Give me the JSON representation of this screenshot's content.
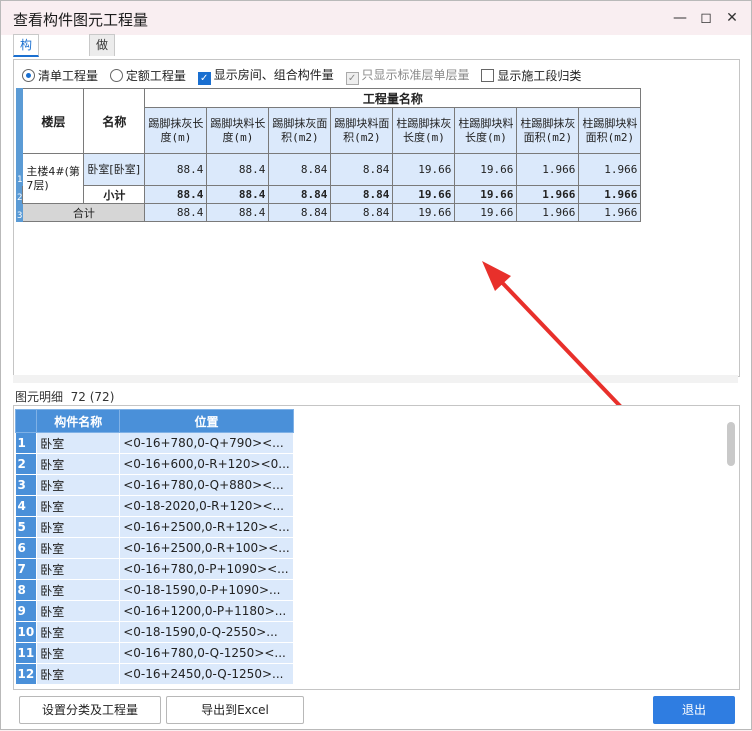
{
  "window": {
    "title": "查看构件图元工程量"
  },
  "tabs": [
    "构件工程量",
    "做法工程量"
  ],
  "options": {
    "radio_list": "清单工程量",
    "radio_quota": "定额工程量",
    "cb_show_room": "显示房间、组合构件量",
    "cb_standard_floor": "只显示标准层单层量",
    "cb_construction": "显示施工段归类"
  },
  "qty_table": {
    "floor_header": "楼层",
    "name_header": "名称",
    "group_header": "工程量名称",
    "columns": [
      "踢脚抹灰长度(m)",
      "踢脚块料长度(m)",
      "踢脚抹灰面积(m2)",
      "踢脚块料面积(m2)",
      "柱踢脚抹灰长度(m)",
      "柱踢脚块料长度(m)",
      "柱踢脚抹灰面积(m2)",
      "柱踢脚块料面积(m2)"
    ],
    "row_numbers": [
      "1",
      "2",
      "3"
    ],
    "floor": "主楼4#(第7层)",
    "name": "卧室[卧室]",
    "values": [
      "88.4",
      "88.4",
      "8.84",
      "8.84",
      "19.66",
      "19.66",
      "1.966",
      "1.966"
    ],
    "subtotal_label": "小计",
    "subtotal": [
      "88.4",
      "88.4",
      "8.84",
      "8.84",
      "19.66",
      "19.66",
      "1.966",
      "1.966"
    ],
    "total_label": "合计",
    "total": [
      "88.4",
      "88.4",
      "8.84",
      "8.84",
      "19.66",
      "19.66",
      "1.966",
      "1.966"
    ]
  },
  "detail": {
    "label": "图元明细",
    "count": "72 (72)",
    "col_name": "构件名称",
    "col_pos": "位置",
    "rows": [
      {
        "n": "1",
        "name": "卧室",
        "pos": "<0-16+780,0-Q+790><..."
      },
      {
        "n": "2",
        "name": "卧室",
        "pos": "<0-16+600,0-R+120><0..."
      },
      {
        "n": "3",
        "name": "卧室",
        "pos": "<0-16+780,0-Q+880><..."
      },
      {
        "n": "4",
        "name": "卧室",
        "pos": "<0-18-2020,0-R+120><..."
      },
      {
        "n": "5",
        "name": "卧室",
        "pos": "<0-16+2500,0-R+120><..."
      },
      {
        "n": "6",
        "name": "卧室",
        "pos": "<0-16+2500,0-R+100><..."
      },
      {
        "n": "7",
        "name": "卧室",
        "pos": "<0-16+780,0-P+1090><..."
      },
      {
        "n": "8",
        "name": "卧室",
        "pos": "<0-18-1590,0-P+1090>..."
      },
      {
        "n": "9",
        "name": "卧室",
        "pos": "<0-16+1200,0-P+1180>..."
      },
      {
        "n": "10",
        "name": "卧室",
        "pos": "<0-18-1590,0-Q-2550>..."
      },
      {
        "n": "11",
        "name": "卧室",
        "pos": "<0-16+780,0-Q-1250><..."
      },
      {
        "n": "12",
        "name": "卧室",
        "pos": "<0-16+2450,0-Q-1250>..."
      }
    ]
  },
  "buttons": {
    "settings": "设置分类及工程量",
    "export": "导出到Excel",
    "exit": "退出"
  },
  "colors": {
    "accent": "#2f7de1",
    "annotation_arrow": "#e8302b",
    "cell_bg": "#dbe9fb"
  }
}
